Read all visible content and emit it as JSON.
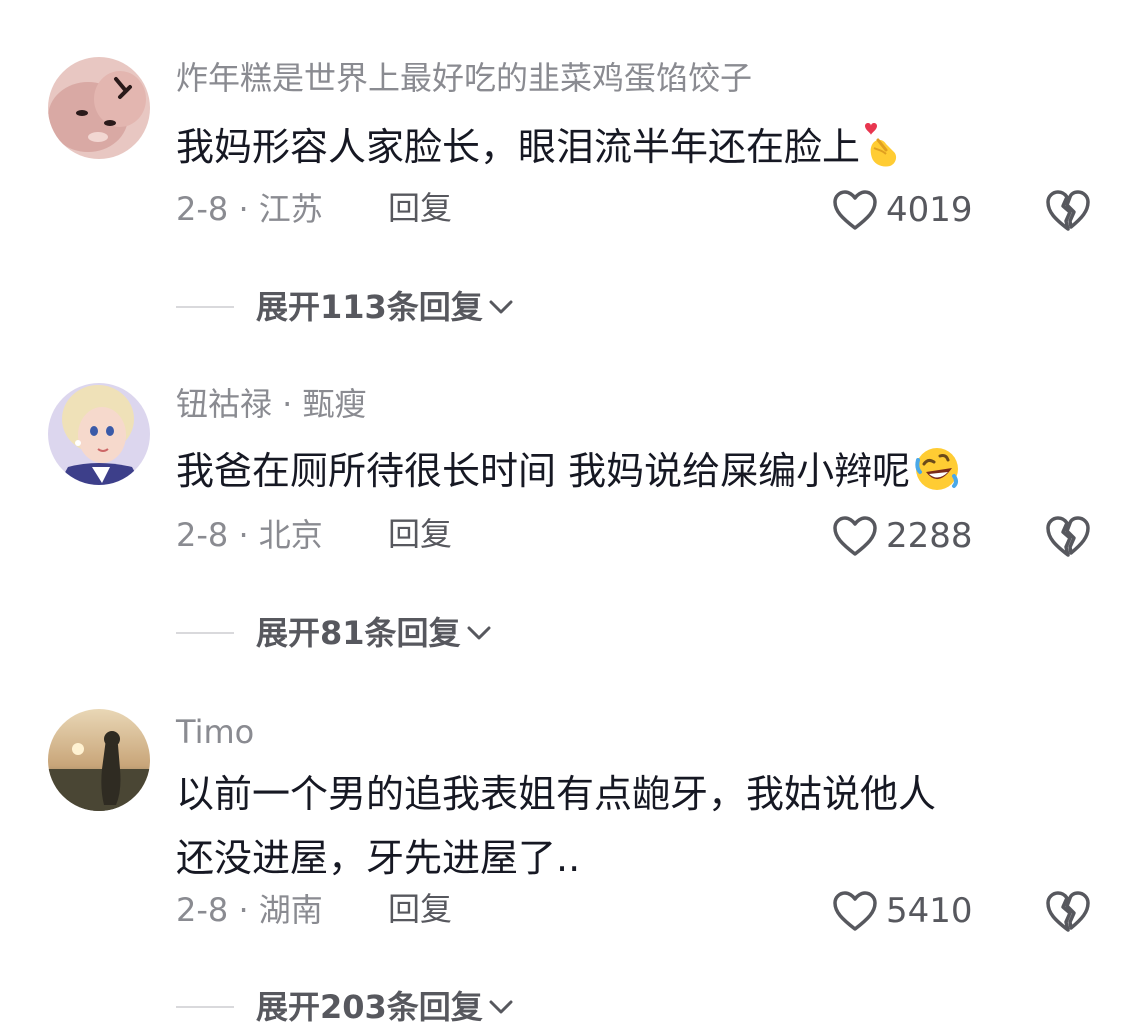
{
  "comments": [
    {
      "username": "炸年糕是世界上最好吃的韭菜鸡蛋馅饺子",
      "content_lines": [
        "我妈形容人家脸长，眼泪流半年还在脸上"
      ],
      "emoji_icon": "finger-heart-icon",
      "date_location": "2-8 · 江苏",
      "reply_label": "回复",
      "like_count": "4019",
      "expand_label": "展开113条回复"
    },
    {
      "username": "钮祜禄 · 甄瘦",
      "content_lines": [
        "我爸在厕所待很长时间 我妈说给屎编小辫呢"
      ],
      "emoji_icon": "rolling-on-floor-laughing-icon",
      "date_location": "2-8 · 北京",
      "reply_label": "回复",
      "like_count": "2288",
      "expand_label": "展开81条回复"
    },
    {
      "username": "Timo",
      "content_lines": [
        "以前一个男的追我表姐有点龅牙，我姑说他人",
        "还没进屋，牙先进屋了.."
      ],
      "date_location": "2-8 · 湖南",
      "reply_label": "回复",
      "like_count": "5410",
      "expand_label": "展开203条回复"
    }
  ],
  "colors": {
    "text_primary": "#161823",
    "text_secondary": "#8a8b91",
    "icon_gray": "#57585e"
  }
}
